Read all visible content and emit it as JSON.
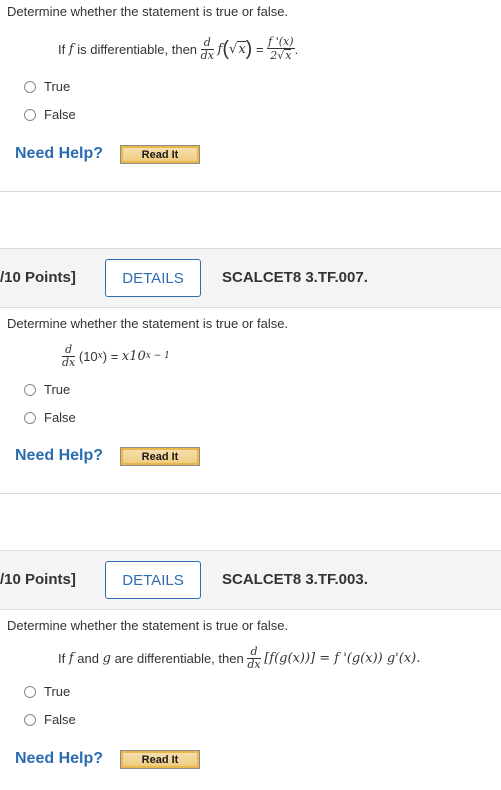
{
  "q1": {
    "instruction": "Determine whether the statement is true or false.",
    "prefix": "If",
    "f": "f",
    "mid": "is differentiable, then",
    "d": "d",
    "dx": "dx",
    "f2": "f",
    "open": "(",
    "sqrt_sym": "√",
    "x": "x",
    "close": ")",
    "eq": "=",
    "num": "f '(x)",
    "den_two": "2",
    "den_x": "x",
    "period": ".",
    "option_true": "True",
    "option_false": "False",
    "need_help": "Need Help?",
    "read_it": "Read It"
  },
  "q2": {
    "points": "/10 Points]",
    "details": "DETAILS",
    "code": "SCALCET8 3.TF.007.",
    "instruction": "Determine whether the statement is true or false.",
    "d": "d",
    "dx": "dx",
    "lhs": "(10",
    "lhs_exp": "x",
    "lhs_close": ") =",
    "rhs": "x10",
    "rhs_exp": "x − 1",
    "option_true": "True",
    "option_false": "False",
    "need_help": "Need Help?",
    "read_it": "Read It"
  },
  "q3": {
    "points": "/10 Points]",
    "details": "DETAILS",
    "code": "SCALCET8 3.TF.003.",
    "instruction": "Determine whether the statement is true or false.",
    "prefix": "If",
    "f": "f",
    "and": "and",
    "g": "g",
    "mid": "are differentiable, then",
    "d": "d",
    "dx": "dx",
    "expr": "[f(g(x))] = f '(g(x)) g'(x).",
    "option_true": "True",
    "option_false": "False",
    "need_help": "Need Help?",
    "read_it": "Read It"
  }
}
